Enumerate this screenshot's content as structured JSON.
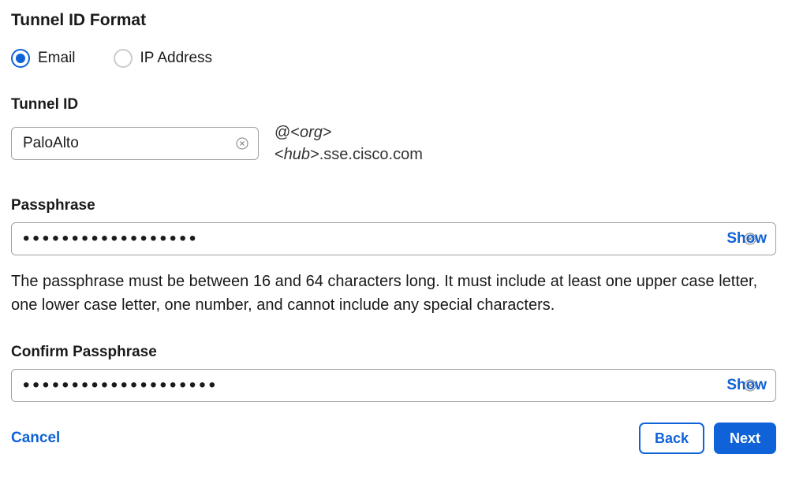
{
  "header": {
    "title": "Tunnel ID Format"
  },
  "radio": {
    "email_label": "Email",
    "ip_label": "IP Address",
    "selected": "email"
  },
  "tunnel_id": {
    "label": "Tunnel ID",
    "value": "PaloAlto",
    "suffix_line1_prefix": "@<",
    "suffix_line1_org": "org",
    "suffix_line1_suffix": ">",
    "suffix_line2_prefix": "<",
    "suffix_line2_hub": "hub",
    "suffix_line2_suffix": ">.sse.cisco.com"
  },
  "passphrase": {
    "label": "Passphrase",
    "value": "••••••••••••••••••",
    "show_label": "Show",
    "help_text": "The passphrase must be between 16 and 64 characters long. It must include at least one upper case letter, one lower case letter, one number, and cannot include any special characters."
  },
  "confirm": {
    "label": "Confirm Passphrase",
    "value": "••••••••••••••••••••",
    "show_label": "Show"
  },
  "footer": {
    "cancel_label": "Cancel",
    "back_label": "Back",
    "next_label": "Next"
  }
}
